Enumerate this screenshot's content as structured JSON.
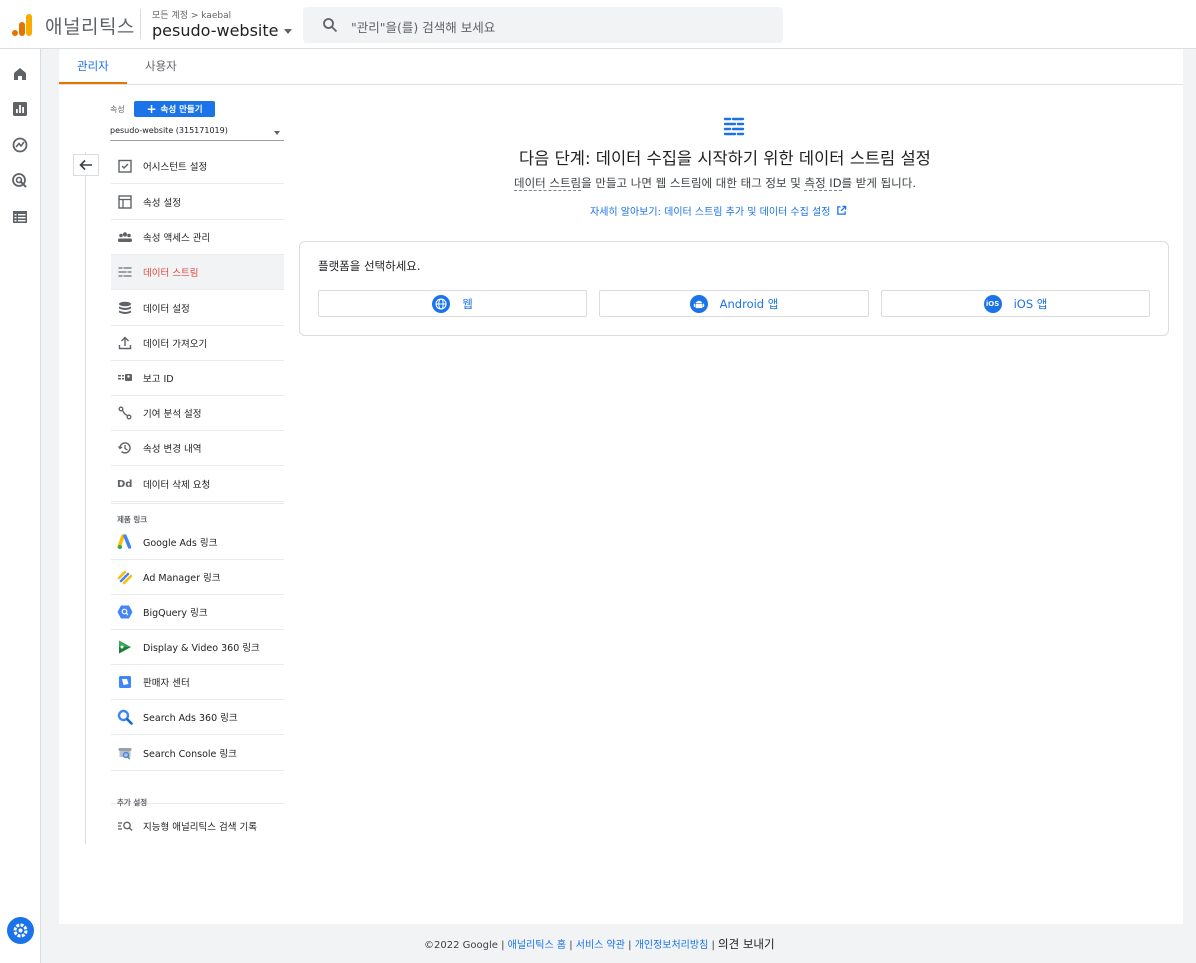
{
  "header": {
    "app_name": "애널리틱스",
    "account_path": "모든 계정 > kaebal",
    "property_name": "pesudo-website",
    "search_placeholder": "\"관리\"을(를) 검색해 보세요"
  },
  "tabs": [
    {
      "label": "관리자",
      "active": true
    },
    {
      "label": "사용자",
      "active": false
    }
  ],
  "sidebar": {
    "property_label": "속성",
    "create_button": "속성 만들기",
    "property_dropdown": "pesudo-website (315171019)",
    "items": [
      {
        "label": "어시스턴트 설정",
        "icon": "checklist-icon"
      },
      {
        "label": "속성 설정",
        "icon": "property-settings-icon"
      },
      {
        "label": "속성 액세스 관리",
        "icon": "people-icon"
      },
      {
        "label": "데이터 스트림",
        "icon": "data-stream-icon",
        "active": true
      },
      {
        "label": "데이터 설정",
        "icon": "database-icon"
      },
      {
        "label": "데이터 가져오기",
        "icon": "upload-icon"
      },
      {
        "label": "보고 ID",
        "icon": "reporting-id-icon"
      },
      {
        "label": "기여 분석 설정",
        "icon": "attribution-icon"
      },
      {
        "label": "속성 변경 내역",
        "icon": "history-icon"
      },
      {
        "label": "데이터 삭제 요청",
        "icon": "data-deletion-icon"
      }
    ],
    "product_links_label": "제품 링크",
    "product_links": [
      {
        "label": "Google Ads 링크",
        "icon": "google-ads-icon"
      },
      {
        "label": "Ad Manager 링크",
        "icon": "ad-manager-icon"
      },
      {
        "label": "BigQuery 링크",
        "icon": "bigquery-icon"
      },
      {
        "label": "Display & Video 360 링크",
        "icon": "display-video-360-icon"
      },
      {
        "label": "판매자 센터",
        "icon": "merchant-center-icon"
      },
      {
        "label": "Search Ads 360 링크",
        "icon": "search-ads-360-icon"
      },
      {
        "label": "Search Console 링크",
        "icon": "search-console-icon"
      }
    ],
    "additional_settings_label": "추가 설정",
    "additional_items": [
      {
        "label": "지능형 애널리틱스 검색 기록",
        "icon": "search-history-icon"
      }
    ]
  },
  "main": {
    "title": "다음 단계: 데이터 수집을 시작하기 위한 데이터 스트림 설정",
    "subtitle_parts": [
      "데이터 스트림",
      "을 만들고 나면 웹 스트림에 대한 태그 정보 및 ",
      "측정 ID",
      "를 받게 됩니다."
    ],
    "learn_more": "자세히 알아보기: 데이터 스트림 추가 및 데이터 수집 설정",
    "platform_prompt": "플랫폼을 선택하세요.",
    "platforms": [
      {
        "label": "웹",
        "icon": "globe-icon"
      },
      {
        "label": "Android 앱",
        "icon": "android-icon"
      },
      {
        "label": "iOS 앱",
        "icon": "ios-icon"
      }
    ]
  },
  "footer": {
    "copyright": "©2022 Google |",
    "links": [
      "애널리틱스 홈",
      "서비스 약관",
      "개인정보처리방침"
    ],
    "feedback": "의견 보내기"
  },
  "colors": {
    "accent": "#1a73e8",
    "active_tab_underline": "#e37400",
    "active_nav_text": "#e8453c"
  }
}
